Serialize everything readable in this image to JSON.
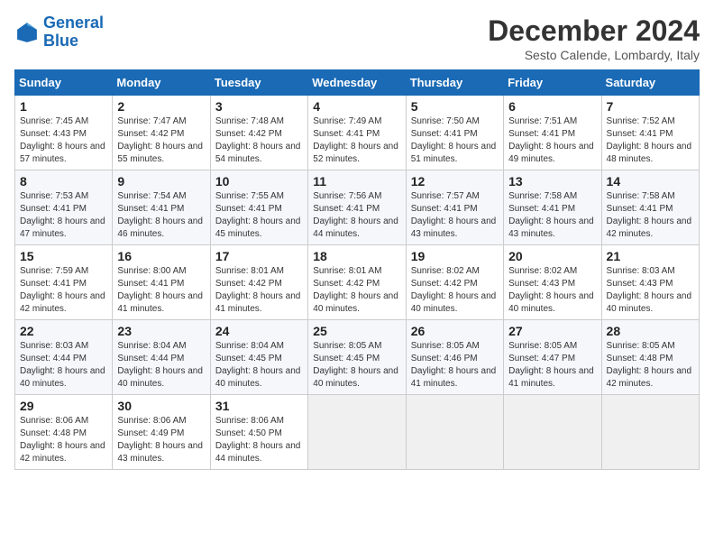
{
  "header": {
    "logo_line1": "General",
    "logo_line2": "Blue",
    "title": "December 2024",
    "subtitle": "Sesto Calende, Lombardy, Italy"
  },
  "calendar": {
    "columns": [
      "Sunday",
      "Monday",
      "Tuesday",
      "Wednesday",
      "Thursday",
      "Friday",
      "Saturday"
    ],
    "weeks": [
      [
        null,
        {
          "day": 1,
          "sunrise": "7:45 AM",
          "sunset": "4:43 PM",
          "daylight": "8 hours and 57 minutes."
        },
        {
          "day": 2,
          "sunrise": "7:47 AM",
          "sunset": "4:42 PM",
          "daylight": "8 hours and 55 minutes."
        },
        {
          "day": 3,
          "sunrise": "7:48 AM",
          "sunset": "4:42 PM",
          "daylight": "8 hours and 54 minutes."
        },
        {
          "day": 4,
          "sunrise": "7:49 AM",
          "sunset": "4:41 PM",
          "daylight": "8 hours and 52 minutes."
        },
        {
          "day": 5,
          "sunrise": "7:50 AM",
          "sunset": "4:41 PM",
          "daylight": "8 hours and 51 minutes."
        },
        {
          "day": 6,
          "sunrise": "7:51 AM",
          "sunset": "4:41 PM",
          "daylight": "8 hours and 49 minutes."
        },
        {
          "day": 7,
          "sunrise": "7:52 AM",
          "sunset": "4:41 PM",
          "daylight": "8 hours and 48 minutes."
        }
      ],
      [
        {
          "day": 8,
          "sunrise": "7:53 AM",
          "sunset": "4:41 PM",
          "daylight": "8 hours and 47 minutes."
        },
        {
          "day": 9,
          "sunrise": "7:54 AM",
          "sunset": "4:41 PM",
          "daylight": "8 hours and 46 minutes."
        },
        {
          "day": 10,
          "sunrise": "7:55 AM",
          "sunset": "4:41 PM",
          "daylight": "8 hours and 45 minutes."
        },
        {
          "day": 11,
          "sunrise": "7:56 AM",
          "sunset": "4:41 PM",
          "daylight": "8 hours and 44 minutes."
        },
        {
          "day": 12,
          "sunrise": "7:57 AM",
          "sunset": "4:41 PM",
          "daylight": "8 hours and 43 minutes."
        },
        {
          "day": 13,
          "sunrise": "7:58 AM",
          "sunset": "4:41 PM",
          "daylight": "8 hours and 43 minutes."
        },
        {
          "day": 14,
          "sunrise": "7:58 AM",
          "sunset": "4:41 PM",
          "daylight": "8 hours and 42 minutes."
        }
      ],
      [
        {
          "day": 15,
          "sunrise": "7:59 AM",
          "sunset": "4:41 PM",
          "daylight": "8 hours and 42 minutes."
        },
        {
          "day": 16,
          "sunrise": "8:00 AM",
          "sunset": "4:41 PM",
          "daylight": "8 hours and 41 minutes."
        },
        {
          "day": 17,
          "sunrise": "8:01 AM",
          "sunset": "4:42 PM",
          "daylight": "8 hours and 41 minutes."
        },
        {
          "day": 18,
          "sunrise": "8:01 AM",
          "sunset": "4:42 PM",
          "daylight": "8 hours and 40 minutes."
        },
        {
          "day": 19,
          "sunrise": "8:02 AM",
          "sunset": "4:42 PM",
          "daylight": "8 hours and 40 minutes."
        },
        {
          "day": 20,
          "sunrise": "8:02 AM",
          "sunset": "4:43 PM",
          "daylight": "8 hours and 40 minutes."
        },
        {
          "day": 21,
          "sunrise": "8:03 AM",
          "sunset": "4:43 PM",
          "daylight": "8 hours and 40 minutes."
        }
      ],
      [
        {
          "day": 22,
          "sunrise": "8:03 AM",
          "sunset": "4:44 PM",
          "daylight": "8 hours and 40 minutes."
        },
        {
          "day": 23,
          "sunrise": "8:04 AM",
          "sunset": "4:44 PM",
          "daylight": "8 hours and 40 minutes."
        },
        {
          "day": 24,
          "sunrise": "8:04 AM",
          "sunset": "4:45 PM",
          "daylight": "8 hours and 40 minutes."
        },
        {
          "day": 25,
          "sunrise": "8:05 AM",
          "sunset": "4:45 PM",
          "daylight": "8 hours and 40 minutes."
        },
        {
          "day": 26,
          "sunrise": "8:05 AM",
          "sunset": "4:46 PM",
          "daylight": "8 hours and 41 minutes."
        },
        {
          "day": 27,
          "sunrise": "8:05 AM",
          "sunset": "4:47 PM",
          "daylight": "8 hours and 41 minutes."
        },
        {
          "day": 28,
          "sunrise": "8:05 AM",
          "sunset": "4:48 PM",
          "daylight": "8 hours and 42 minutes."
        }
      ],
      [
        {
          "day": 29,
          "sunrise": "8:06 AM",
          "sunset": "4:48 PM",
          "daylight": "8 hours and 42 minutes."
        },
        {
          "day": 30,
          "sunrise": "8:06 AM",
          "sunset": "4:49 PM",
          "daylight": "8 hours and 43 minutes."
        },
        {
          "day": 31,
          "sunrise": "8:06 AM",
          "sunset": "4:50 PM",
          "daylight": "8 hours and 44 minutes."
        },
        null,
        null,
        null,
        null
      ]
    ]
  }
}
